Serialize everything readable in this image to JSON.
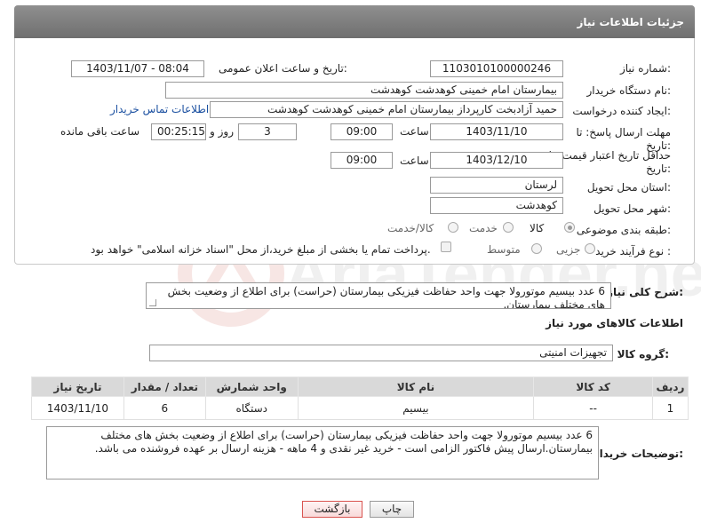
{
  "header": {
    "title": "جزئیات اطلاعات نیاز"
  },
  "form": {
    "need_number_label": "شماره نیاز:",
    "need_number": "1103010100000246",
    "announce_label": "تاریخ و ساعت اعلان عمومی:",
    "announce_value": "1403/11/07 - 08:04",
    "buyer_org_label": "نام دستگاه خریدار:",
    "buyer_org": "بیمارستان امام خمینی کوهدشت کوهدشت",
    "creator_label": "ایجاد کننده درخواست:",
    "creator": "حمید آزادبخت کارپرداز بیمارستان امام خمینی کوهدشت کوهدشت",
    "buyer_contact_link": "اطلاعات تماس خریدار",
    "deadline_label": "مهلت ارسال پاسخ: تا تاریخ:",
    "deadline_date": "1403/11/10",
    "time_label": "ساعت",
    "deadline_time": "09:00",
    "days_value": "3",
    "days_label": "روز و",
    "remaining_value": "00:25:15",
    "remaining_label": "ساعت باقی مانده",
    "price_valid_label": "حداقل تاریخ اعتبار قیمت: تا تاریخ:",
    "price_valid_date": "1403/12/10",
    "price_valid_time": "09:00",
    "province_label": "استان محل تحویل:",
    "province": "لرستان",
    "city_label": "شهر محل تحویل:",
    "city": "کوهدشت",
    "category_label": "طبقه بندی موضوعی:",
    "category_options": [
      "کالا",
      "خدمت",
      "کالا/خدمت"
    ],
    "process_label": "نوع فرآیند خرید :",
    "process_options": [
      "جزیی",
      "متوسط"
    ],
    "payment_note": "پرداخت تمام یا بخشی از مبلغ خرید،از محل \"اسناد خزانه اسلامی\" خواهد بود."
  },
  "summary": {
    "label": "شرح کلی نیاز:",
    "text": "6 عدد بیسیم موتورولا جهت واحد حفاظت فیزیکی بیمارستان (حراست) برای اطلاع از وضعیت بخش های مختلف بیمارستان."
  },
  "goods": {
    "section_title": "اطلاعات کالاهای مورد نیاز",
    "group_label": "گروه کالا:",
    "group_value": "تجهیزات امنیتی",
    "columns": [
      "ردیف",
      "کد کالا",
      "نام کالا",
      "واحد شمارش",
      "تعداد / مقدار",
      "تاریخ نیاز"
    ],
    "rows": [
      {
        "row": "1",
        "code": "--",
        "name": "بیسیم",
        "unit": "دستگاه",
        "qty": "6",
        "date": "1403/11/10"
      }
    ]
  },
  "buyer_notes": {
    "label": "توضیحات خریدار:",
    "text": "6 عدد بیسیم موتورولا جهت واحد حفاظت فیزیکی بیمارستان (حراست) برای اطلاع از وضعیت بخش های مختلف بیمارستان.ارسال پیش فاکتور الزامی است - خرید غیر نقدی و 4 ماهه - هزینه ارسال بر عهده فروشنده می باشد."
  },
  "buttons": {
    "print": "چاپ",
    "back": "بازگشت"
  },
  "watermark": {
    "text": "AriaTender.net"
  },
  "colors": {
    "header_bg": "#7f7f7f",
    "link": "#1a4fa0",
    "back_button_border": "#d9534f"
  }
}
